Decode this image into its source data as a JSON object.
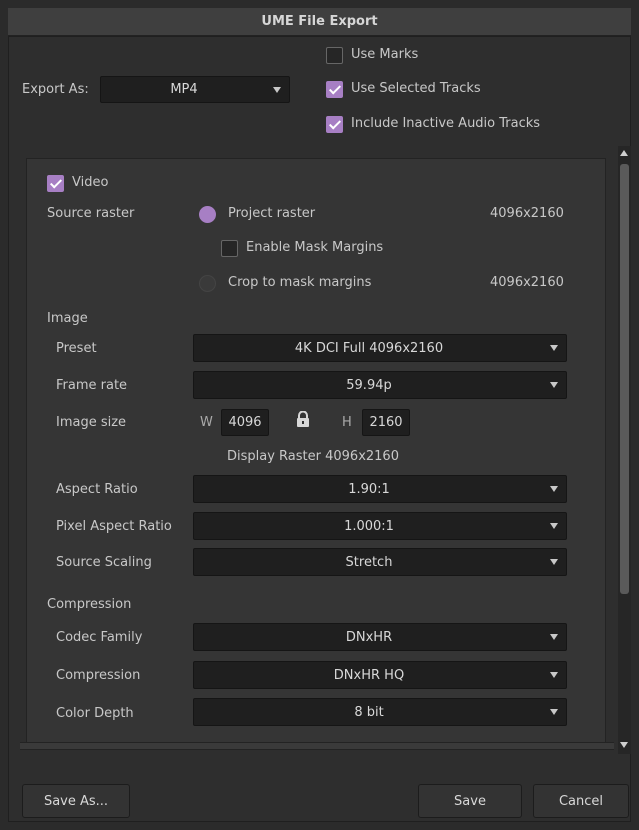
{
  "window": {
    "title": "UME File Export"
  },
  "export": {
    "label": "Export As:",
    "format": "MP4",
    "use_marks": {
      "label": "Use Marks",
      "checked": false
    },
    "use_selected_tracks": {
      "label": "Use Selected Tracks",
      "checked": true
    },
    "include_inactive_audio": {
      "label": "Include Inactive Audio Tracks",
      "checked": true
    }
  },
  "video": {
    "label": "Video",
    "checked": true,
    "source_raster": {
      "label": "Source raster",
      "project_raster": {
        "label": "Project raster",
        "value": "4096x2160",
        "selected": true
      },
      "enable_mask_margins": {
        "label": "Enable Mask Margins",
        "checked": false
      },
      "crop_to_mask": {
        "label": "Crop to mask margins",
        "value": "4096x2160",
        "selected": false
      }
    }
  },
  "image": {
    "section_label": "Image",
    "preset": {
      "label": "Preset",
      "value": "4K DCI Full 4096x2160"
    },
    "frame_rate": {
      "label": "Frame rate",
      "value": "59.94p"
    },
    "image_size": {
      "label": "Image size",
      "w_label": "W",
      "w": "4096",
      "h_label": "H",
      "h": "2160"
    },
    "display_raster": "Display Raster  4096x2160",
    "aspect_ratio": {
      "label": "Aspect Ratio",
      "value": "1.90:1"
    },
    "pixel_aspect_ratio": {
      "label": "Pixel Aspect Ratio",
      "value": "1.000:1"
    },
    "source_scaling": {
      "label": "Source Scaling",
      "value": "Stretch"
    }
  },
  "compression": {
    "section_label": "Compression",
    "codec_family": {
      "label": "Codec Family",
      "value": "DNxHR"
    },
    "compression": {
      "label": "Compression",
      "value": "DNxHR HQ"
    },
    "color_depth": {
      "label": "Color Depth",
      "value": "8 bit"
    }
  },
  "buttons": {
    "save_as": "Save As...",
    "save": "Save",
    "cancel": "Cancel"
  },
  "icons": {
    "lock": "lock-icon",
    "dropdown": "chevron-down-icon"
  },
  "colors": {
    "accent": "#a77fc4",
    "background": "#2e2e2e",
    "panel": "#353535",
    "field": "#1f1f1f"
  }
}
